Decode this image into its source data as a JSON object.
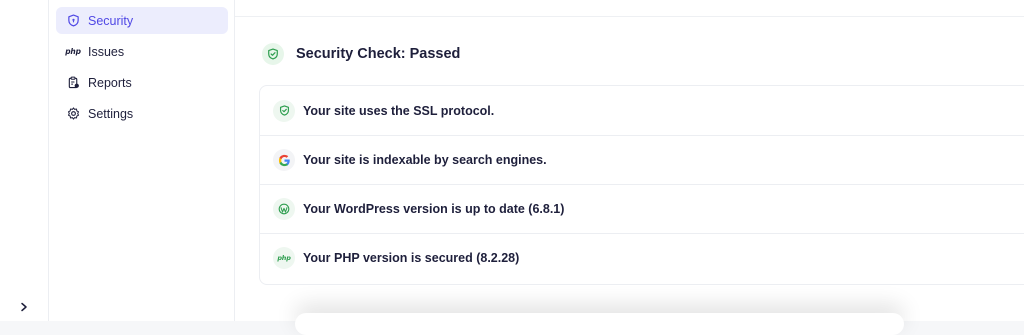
{
  "sidebar": {
    "items": [
      {
        "label": "Security",
        "icon": "shield-icon",
        "active": true
      },
      {
        "label": "Issues",
        "icon": "php-icon",
        "icon_text": "php"
      },
      {
        "label": "Reports",
        "icon": "clipboard-icon"
      },
      {
        "label": "Settings",
        "icon": "gear-icon"
      }
    ],
    "expand_icon": "chevron-right-icon"
  },
  "main": {
    "title": "Security Check: Passed",
    "title_icon": "shield-check-icon",
    "checks": [
      {
        "text": "Your site uses the SSL protocol.",
        "icon": "shield-check-icon"
      },
      {
        "text": "Your site is indexable by search engines.",
        "icon": "google-icon"
      },
      {
        "text": "Your WordPress version is up to date (6.8.1)",
        "icon": "wordpress-icon"
      },
      {
        "text": "Your PHP version is secured (8.2.28)",
        "icon": "php-icon",
        "icon_text": "php"
      }
    ]
  },
  "colors": {
    "accent": "#5048e5",
    "active_bg": "#ecedfd",
    "success": "#2e9e4f",
    "success_bg": "#e7f6ea",
    "text": "#1e1f3b"
  }
}
